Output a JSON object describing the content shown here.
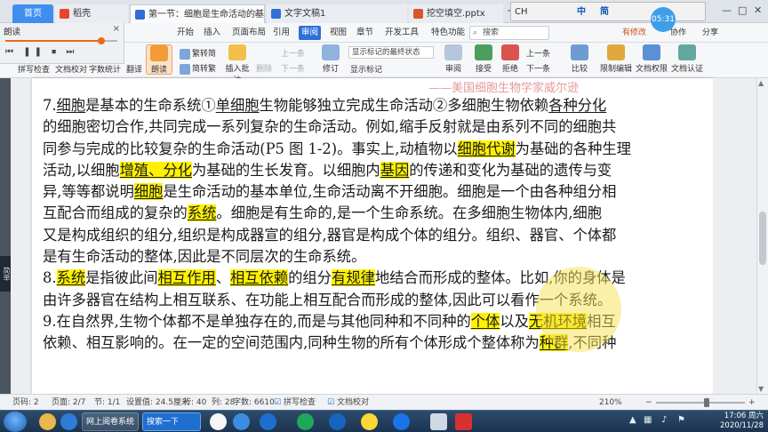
{
  "tabs": [
    {
      "label": "首页"
    },
    {
      "label": "稻壳"
    },
    {
      "label": "第一节：细胞是生命活动的基本单位"
    },
    {
      "label": "文字文稿1"
    },
    {
      "label": "挖空填空.pptx"
    }
  ],
  "tab_close": "×",
  "tab_add": "+",
  "ime": {
    "label1": "CH",
    "label2": "中",
    "label3": "简"
  },
  "screen_clock": "05:31",
  "ribbon": {
    "menus": [
      "开始",
      "插入",
      "页面布局",
      "引用",
      "审阅",
      "视图",
      "章节",
      "开发工具",
      "特色功能"
    ],
    "active_menu": "审阅",
    "search_placeholder": "搜索",
    "right": {
      "unsaved": "有修改",
      "collab": "协作",
      "share": "分享"
    }
  },
  "read_panel": {
    "title": "朗读",
    "close": "×",
    "progress_pct": 86,
    "controls": [
      "⏮",
      "❚❚",
      "⏹",
      "⏭"
    ]
  },
  "toolbar": {
    "spell_check": "拼写检查",
    "doc_proof": "文档校对",
    "word_count": "字数统计",
    "translate": "翻译",
    "read": "朗读",
    "trad_to_simp": "繁转简",
    "simp_to_trad": "简转繁",
    "insert_comment": "插入批注",
    "delete": "删除",
    "prev_comment": "上一条",
    "next_comment": "下一条",
    "revise": "修订",
    "final_state_label": "显示标记的最终状态",
    "show_markup": "显示标记",
    "review": "审阅",
    "accept": "接受",
    "reject": "拒绝",
    "prev_change": "上一条",
    "next_change": "下一条",
    "compare": "比较",
    "restrict_edit": "限制编辑",
    "doc_rights": "文档权限",
    "doc_cert": "文档认证"
  },
  "document": {
    "header": "——美国细胞生物学家威尔逊",
    "lines": [
      [
        {
          "t": "7."
        },
        {
          "t": "细胞",
          "u": true
        },
        {
          "t": "是基本的生命系统①"
        },
        {
          "t": "单细胞",
          "u": true
        },
        {
          "t": "生物能够独立完成生命活动②多细胞生物依赖"
        },
        {
          "t": "各种分化",
          "u": true
        }
      ],
      [
        {
          "t": "的细胞密切合作,共同完成一系列复杂的生命活动。例如,缩手反射就是由系列不同的细胞共"
        }
      ],
      [
        {
          "t": "同参与完成的比较复杂的生命活动(P5 图 1-2)。事实上,动植物以"
        },
        {
          "t": "细胞代谢",
          "h": true,
          "u": true
        },
        {
          "t": "为基础的各种生理"
        }
      ],
      [
        {
          "t": "活动,以细胞"
        },
        {
          "t": "增殖、分化",
          "h": true,
          "u": true
        },
        {
          "t": "为基础的生长发育。以细胞内"
        },
        {
          "t": "基因",
          "h": true,
          "u": true
        },
        {
          "t": "的传递和变化为基础的遗传与变"
        }
      ],
      [
        {
          "t": "异,等等都说明"
        },
        {
          "t": "细胞",
          "h": true,
          "u": true
        },
        {
          "t": "是生命活动的基本单位,生命活动离不开细胞。细胞是一个由各种组分相"
        }
      ],
      [
        {
          "t": "互配合而组成的复杂的"
        },
        {
          "t": "系统",
          "h": true,
          "u": true
        },
        {
          "t": "。细胞是有生命的,是一个生命系统。在多细胞生物体内,细胞"
        }
      ],
      [
        {
          "t": "又是构成组织的组分,组织是构成器宣的组分,器官是构成个体的组分。组织、器官、个体都"
        }
      ],
      [
        {
          "t": "是有生命活动的整体,因此是不同层次的生命系统。"
        }
      ],
      [
        {
          "t": "8."
        },
        {
          "t": "系统",
          "h": true,
          "u": true
        },
        {
          "t": "是指彼此间"
        },
        {
          "t": "相互作用",
          "h": true,
          "u": true
        },
        {
          "t": "、"
        },
        {
          "t": "相互依赖",
          "h": true,
          "u": true
        },
        {
          "t": "的组分"
        },
        {
          "t": "有规律",
          "h": true,
          "u": true
        },
        {
          "t": "地结合而形成的整体。比如,你的身体是"
        }
      ],
      [
        {
          "t": "由许多器官在结构上相互联系、在功能上相互配合而形成的整体,因此可以看作一个系统。"
        }
      ],
      [
        {
          "t": "9.在自然界,生物个体都不是单独存在的,而是与其他同种和不同种的"
        },
        {
          "t": "个体",
          "h": true,
          "u": true
        },
        {
          "t": "以及"
        },
        {
          "t": "无机环境",
          "h": true,
          "u": true
        },
        {
          "t": "相互"
        }
      ],
      [
        {
          "t": "依赖、相互影响的。在一定的空间范围内,同种生物的所有个体形成个整体称为"
        },
        {
          "t": "种群",
          "h": true,
          "u": true
        },
        {
          "t": ",不同种"
        }
      ]
    ]
  },
  "left_strip_tag": "简单",
  "statusbar": {
    "page_num": "页码: 2",
    "pages": "页面: 2/7",
    "section": "节: 1/1",
    "settings": "设置值: 24.5厘米",
    "row": "行: 40",
    "col": "列: 28",
    "words": "字数: 6610",
    "spell": "拼写检查",
    "proof": "文档校对",
    "zoom": "210%",
    "zoom_minus": "−",
    "zoom_plus": "+"
  },
  "taskbar": {
    "apps": [
      {
        "label": "网上阅卷系统"
      },
      {
        "label": "搜索一下"
      }
    ],
    "time": "17:06 周六",
    "date": "2020/11/28"
  }
}
